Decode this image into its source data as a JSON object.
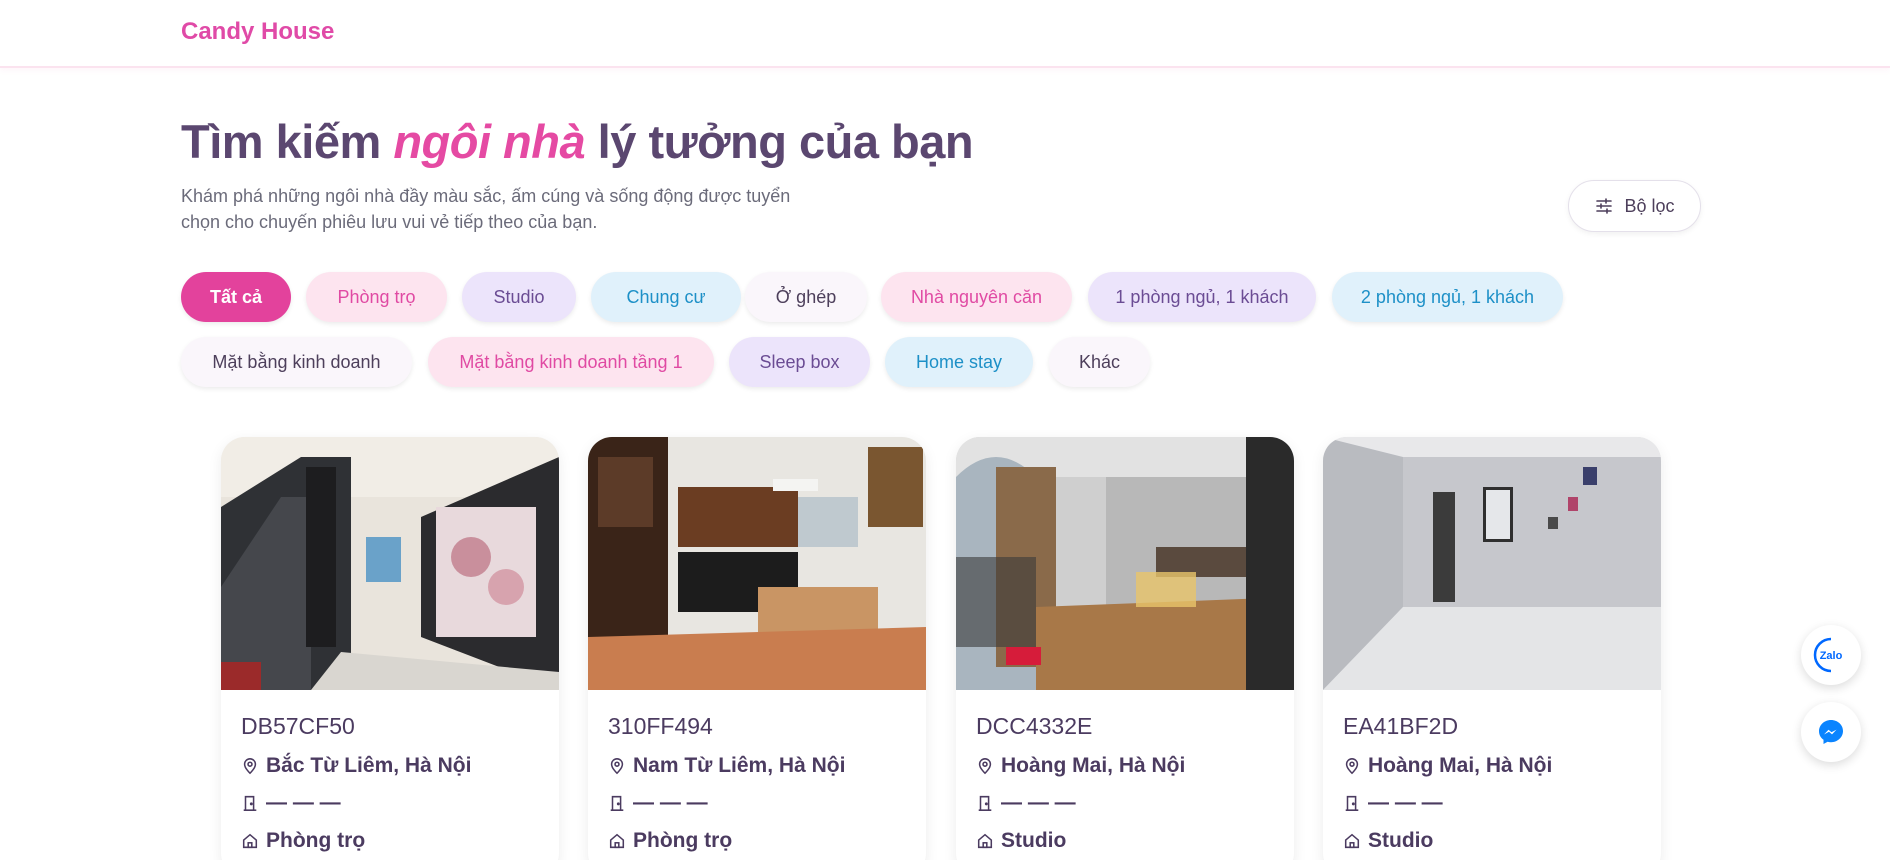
{
  "header": {
    "brand": "Candy House"
  },
  "hero": {
    "title_before": "Tìm kiếm ",
    "title_accent": "ngôi nhà",
    "title_after": " lý tưởng của bạn",
    "subtitle": "Khám phá những ngôi nhà đầy màu sắc, ấm cúng và sống động được tuyển chọn cho chuyến phiêu lưu vui vẻ tiếp theo của bạn."
  },
  "filter_button": {
    "label": "Bộ lọc",
    "icon": "sliders-icon"
  },
  "categories": [
    {
      "label": "Tất cả",
      "active": true
    },
    {
      "label": "Phòng trọ"
    },
    {
      "label": "Studio"
    },
    {
      "label": "Chung cư"
    },
    {
      "label": "Ở ghép"
    },
    {
      "label": "Nhà nguyên căn"
    },
    {
      "label": "1 phòng ngủ, 1 khách"
    },
    {
      "label": "2 phòng ngủ, 1 khách"
    },
    {
      "label": "Mặt bằng kinh doanh"
    },
    {
      "label": "Mặt bằng kinh doanh tầng 1"
    },
    {
      "label": "Sleep box"
    },
    {
      "label": "Home stay"
    },
    {
      "label": "Khác"
    }
  ],
  "listings": [
    {
      "code": "DB57CF50",
      "location": "Bắc Từ Liêm, Hà Nội",
      "area": "— — —",
      "type": "Phòng trọ"
    },
    {
      "code": "310FF494",
      "location": "Nam Từ Liêm, Hà Nội",
      "area": "— — —",
      "type": "Phòng trọ"
    },
    {
      "code": "DCC4332E",
      "location": "Hoàng Mai, Hà Nội",
      "area": "— — —",
      "type": "Studio"
    },
    {
      "code": "EA41BF2D",
      "location": "Hoàng Mai, Hà Nội",
      "area": "— — —",
      "type": "Studio"
    }
  ],
  "floating": {
    "zalo_label": "Zalo",
    "messenger_icon": "messenger-icon"
  },
  "colors": {
    "brand": "#e04aa7",
    "accent_pink": "#e3429c",
    "title": "#5b4770"
  }
}
